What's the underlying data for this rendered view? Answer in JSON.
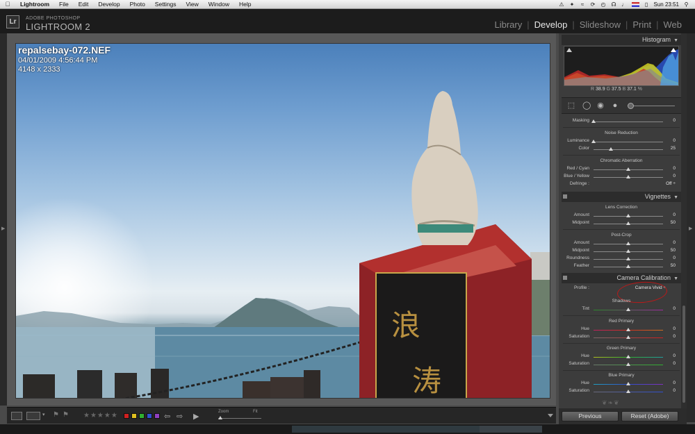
{
  "menubar": {
    "app": "Lightroom",
    "items": [
      "File",
      "Edit",
      "Develop",
      "Photo",
      "Settings",
      "View",
      "Window",
      "Help"
    ],
    "clock": "Sun 23:51"
  },
  "header": {
    "logo_text": "Lr",
    "brand_line1": "ADOBE PHOTOSHOP",
    "brand_line2": "LIGHTROOM 2",
    "modules": [
      "Library",
      "Develop",
      "Slideshow",
      "Print",
      "Web"
    ],
    "active_module": "Develop"
  },
  "photo_info": {
    "filename": "repalsebay-072.NEF",
    "datetime": "04/01/2009 4:56:44 PM",
    "dimensions": "4148 x 2333"
  },
  "histogram": {
    "title": "Histogram",
    "r_label": "R",
    "r_value": "38.9",
    "g_label": "G",
    "g_value": "37.5",
    "b_label": "B",
    "b_value": "37.1",
    "unit": "%"
  },
  "detail": {
    "masking_label": "Masking",
    "masking_value": "0",
    "masking_pos": 0,
    "noise_title": "Noise Reduction",
    "luminance_label": "Luminance",
    "luminance_value": "0",
    "luminance_pos": 0,
    "color_label": "Color",
    "color_value": "25",
    "color_pos": 0.25,
    "ca_title": "Chromatic Aberration",
    "redcyan_label": "Red / Cyan",
    "redcyan_value": "0",
    "redcyan_pos": 0.5,
    "blueyellow_label": "Blue / Yellow",
    "blueyellow_value": "0",
    "blueyellow_pos": 0.5,
    "defringe_label": "Defringe :",
    "defringe_value": "Off ÷"
  },
  "vignettes": {
    "title": "Vignettes",
    "lens_title": "Lens Correction",
    "amount_label": "Amount",
    "amount_value": "0",
    "amount_pos": 0.5,
    "midpoint_label": "Midpoint",
    "midpoint_value": "50",
    "midpoint_pos": 0.5,
    "postcrop_title": "Post-Crop",
    "pc_amount_label": "Amount",
    "pc_amount_value": "0",
    "pc_amount_pos": 0.5,
    "pc_midpoint_label": "Midpoint",
    "pc_midpoint_value": "50",
    "pc_midpoint_pos": 0.5,
    "pc_roundness_label": "Roundness",
    "pc_roundness_value": "0",
    "pc_roundness_pos": 0.5,
    "pc_feather_label": "Feather",
    "pc_feather_value": "50",
    "pc_feather_pos": 0.5
  },
  "calibration": {
    "title": "Camera Calibration",
    "profile_label": "Profile :",
    "profile_value": "Camera Vivid ÷",
    "shadows_title": "Shadows",
    "tint_label": "Tint",
    "tint_value": "0",
    "tint_pos": 0.5,
    "red_title": "Red Primary",
    "red_hue_label": "Hue",
    "red_hue_value": "0",
    "red_hue_pos": 0.5,
    "red_sat_label": "Saturation",
    "red_sat_value": "0",
    "red_sat_pos": 0.5,
    "green_title": "Green Primary",
    "green_hue_label": "Hue",
    "green_hue_value": "0",
    "green_hue_pos": 0.5,
    "green_sat_label": "Saturation",
    "green_sat_value": "0",
    "green_sat_pos": 0.5,
    "blue_title": "Blue Primary",
    "blue_hue_label": "Hue",
    "blue_hue_value": "0",
    "blue_hue_pos": 0.5,
    "blue_sat_label": "Saturation",
    "blue_sat_value": "0",
    "blue_sat_pos": 0.5
  },
  "toolbar": {
    "stars": "★★★★★",
    "zoom_label": "Zoom",
    "fit_label": "Fit"
  },
  "buttons": {
    "previous": "Previous",
    "reset": "Reset (Adobe)"
  },
  "colors": {
    "panel_bg": "#3c3c3c",
    "header_bg": "#1c1c1c",
    "circle_annotation": "#c01818",
    "label_red": "#d02020",
    "label_yellow": "#e0c020",
    "label_green": "#30b030",
    "label_blue": "#3050d0",
    "label_purple": "#9040c0"
  }
}
